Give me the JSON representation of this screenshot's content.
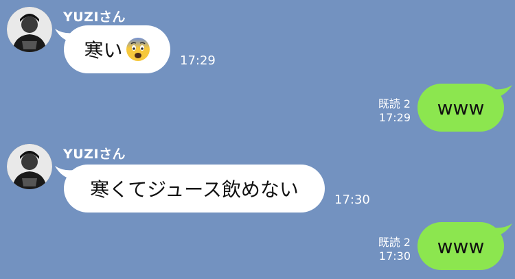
{
  "messages": [
    {
      "sender": "YUZIさん",
      "text": "寒い",
      "emoji": "fearful-face-emoji",
      "time": "17:29"
    },
    {
      "text": "www",
      "read_label": "既読 2",
      "time": "17:29"
    },
    {
      "sender": "YUZIさん",
      "text": "寒くてジュース飲めない",
      "time": "17:30"
    },
    {
      "text": "www",
      "read_label": "既読 2",
      "time": "17:30"
    }
  ],
  "colors": {
    "background": "#7392c0",
    "incoming_bubble": "#ffffff",
    "outgoing_bubble": "#8ce64f"
  }
}
